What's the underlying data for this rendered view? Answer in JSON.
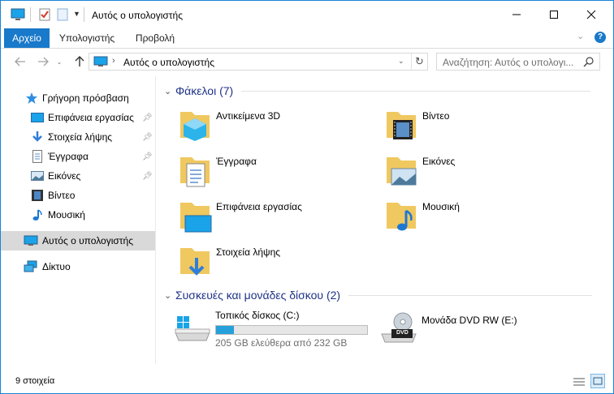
{
  "window": {
    "title": "Αυτός ο υπολογιστής",
    "accent": "#1979ca"
  },
  "ribbon": {
    "tabs": [
      {
        "label": "Αρχείο",
        "active": true
      },
      {
        "label": "Υπολογιστής",
        "active": false
      },
      {
        "label": "Προβολή",
        "active": false
      }
    ]
  },
  "address": {
    "path": "Αυτός ο υπολογιστής",
    "search_placeholder": "Αναζήτηση: Αυτός ο υπολογι..."
  },
  "nav": {
    "quick_access": "Γρήγορη πρόσβαση",
    "items": [
      {
        "label": "Επιφάνεια εργασίας",
        "icon": "desktop-icon",
        "pinned": true
      },
      {
        "label": "Στοιχεία λήψης",
        "icon": "downloads-icon",
        "pinned": true
      },
      {
        "label": "Έγγραφα",
        "icon": "documents-icon",
        "pinned": true
      },
      {
        "label": "Εικόνες",
        "icon": "pictures-icon",
        "pinned": true
      },
      {
        "label": "Βίντεο",
        "icon": "videos-icon",
        "pinned": false
      },
      {
        "label": "Μουσική",
        "icon": "music-icon",
        "pinned": false
      }
    ],
    "this_pc": "Αυτός ο υπολογιστής",
    "network": "Δίκτυο"
  },
  "folders": {
    "header": "Φάκελοι (7)",
    "items": [
      {
        "label": "Αντικείμενα 3D",
        "icon": "3d-objects-folder-icon"
      },
      {
        "label": "Βίντεο",
        "icon": "videos-folder-icon"
      },
      {
        "label": "Έγγραφα",
        "icon": "documents-folder-icon"
      },
      {
        "label": "Εικόνες",
        "icon": "pictures-folder-icon"
      },
      {
        "label": "Επιφάνεια εργασίας",
        "icon": "desktop-folder-icon"
      },
      {
        "label": "Μουσική",
        "icon": "music-folder-icon"
      },
      {
        "label": "Στοιχεία λήψης",
        "icon": "downloads-folder-icon"
      }
    ]
  },
  "devices": {
    "header": "Συσκευές και μονάδες δίσκου (2)",
    "local_disk": {
      "label": "Τοπικός δίσκος (C:)",
      "free_text": "205 GB ελεύθερα από 232 GB",
      "used_fraction": 0.116
    },
    "dvd": {
      "label": "Μονάδα DVD RW (E:)",
      "badge": "DVD"
    }
  },
  "status": {
    "count": "9 στοιχεία"
  }
}
